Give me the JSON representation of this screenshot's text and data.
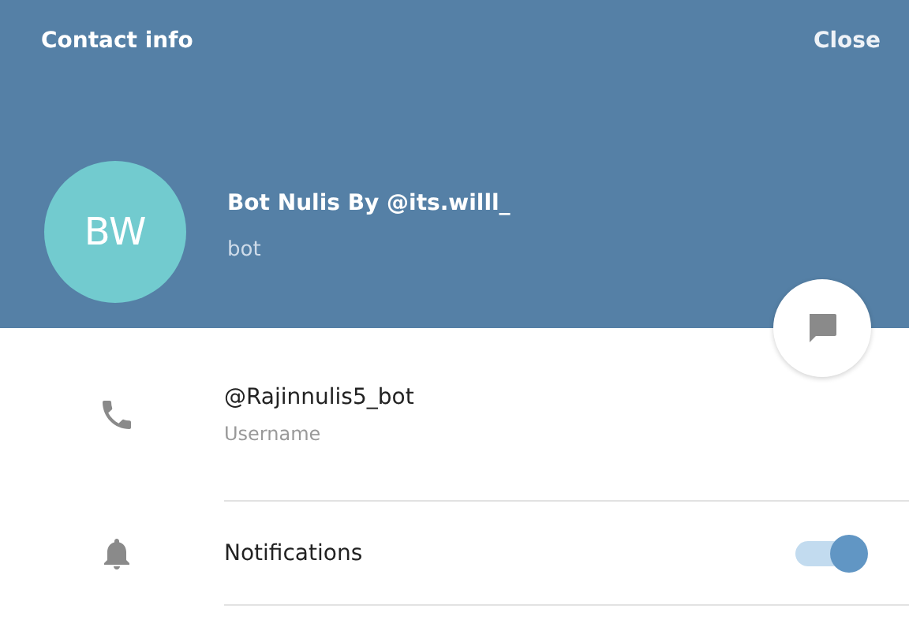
{
  "header": {
    "title": "Contact info",
    "close": "Close"
  },
  "profile": {
    "initials": "BW",
    "name": "Bot Nulis By @its.willl_",
    "status": "bot"
  },
  "rows": [
    {
      "kind": "info",
      "value": "@Rajinnulis5_bot",
      "label": "Username"
    },
    {
      "kind": "toggle",
      "value": "Notifications",
      "on": true
    }
  ]
}
